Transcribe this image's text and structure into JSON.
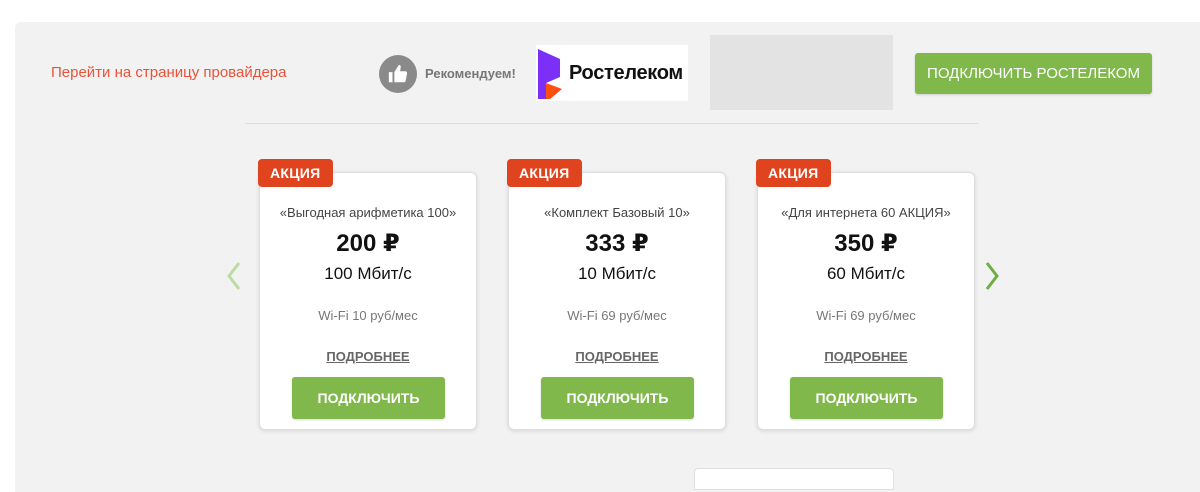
{
  "header": {
    "provider_link": "Перейти на страницу провайдера",
    "recommend_text": "Рекомендуем!",
    "logo_text": "Ростелеком",
    "connect_button": "Подключить Ростелеком"
  },
  "colors": {
    "accent_green": "#80b84c",
    "promo_red": "#e0441e",
    "link_red": "#e8533a",
    "logo_purple": "#7b2ff7",
    "logo_orange": "#ff4f12"
  },
  "icons": {
    "recommend": "thumbs-up-icon",
    "prev": "chevron-left-icon",
    "next": "chevron-right-icon"
  },
  "cards": [
    {
      "badge": "АКЦИЯ",
      "tariff": "«Выгодная арифметика 100»",
      "price": "200 ₽",
      "speed": "100 Мбит/с",
      "wifi": "Wi-Fi 10 руб/мес",
      "details": "подробнее",
      "connect": "подключить"
    },
    {
      "badge": "АКЦИЯ",
      "tariff": "«Комплект Базовый 10»",
      "price": "333 ₽",
      "speed": "10 Мбит/с",
      "wifi": "Wi-Fi 69 руб/мес",
      "details": "подробнее",
      "connect": "подключить"
    },
    {
      "badge": "АКЦИЯ",
      "tariff": "«Для интернета 60 АКЦИЯ»",
      "price": "350 ₽",
      "speed": "60 Мбит/с",
      "wifi": "Wi-Fi 69 руб/мес",
      "details": "подробнее",
      "connect": "подключить"
    }
  ]
}
